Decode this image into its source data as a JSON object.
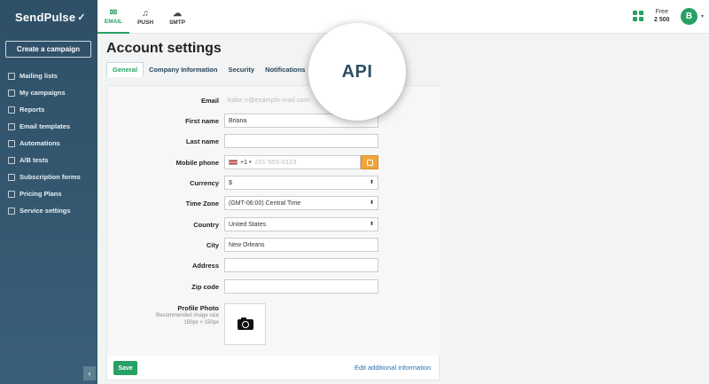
{
  "brand": {
    "name": "SendPulse",
    "mark": "✓"
  },
  "sidebar": {
    "create_label": "Create a campaign",
    "items": [
      {
        "label": "Mailing lists"
      },
      {
        "label": "My campaigns"
      },
      {
        "label": "Reports"
      },
      {
        "label": "Email templates"
      },
      {
        "label": "Automations"
      },
      {
        "label": "A/B tests"
      },
      {
        "label": "Subscription forms"
      },
      {
        "label": "Pricing Plans"
      },
      {
        "label": "Service settings"
      }
    ],
    "collapse_glyph": "‹"
  },
  "topbar": {
    "tabs": [
      {
        "label": "EMAIL",
        "glyph": "✉"
      },
      {
        "label": "PUSH",
        "glyph": "♫"
      },
      {
        "label": "SMTP",
        "glyph": "☁"
      }
    ],
    "plan_name": "Free",
    "plan_count": "2 500",
    "avatar_initial": "B",
    "caret": "▾"
  },
  "page": {
    "title": "Account settings",
    "tabs": [
      {
        "label": "General"
      },
      {
        "label": "Company Information"
      },
      {
        "label": "Security"
      },
      {
        "label": "Notifications"
      },
      {
        "label": "s"
      }
    ],
    "magnifier_text": "API"
  },
  "form": {
    "email": {
      "label": "Email",
      "value": "babe.n@example-mail.com"
    },
    "first_name": {
      "label": "First name",
      "value": "Briana"
    },
    "last_name": {
      "label": "Last name",
      "value": ""
    },
    "mobile_phone": {
      "label": "Mobile phone",
      "code": "+1",
      "code_caret": "▾",
      "value": "201-555-0123"
    },
    "currency": {
      "label": "Currency",
      "value": "$"
    },
    "time_zone": {
      "label": "Time Zone",
      "value": "(GMT-06:00) Central Time"
    },
    "country": {
      "label": "Country",
      "value": "United States"
    },
    "city": {
      "label": "City",
      "value": "New Orleans"
    },
    "address": {
      "label": "Address",
      "value": ""
    },
    "zip_code": {
      "label": "Zip code",
      "value": ""
    },
    "profile_photo": {
      "label": "Profile Photo",
      "hint1": "Recommended image size",
      "hint2": "150px × 150px"
    },
    "select_arrow": "⬍"
  },
  "footer": {
    "save_label": "Save",
    "edit_link": "Edit additional information"
  }
}
